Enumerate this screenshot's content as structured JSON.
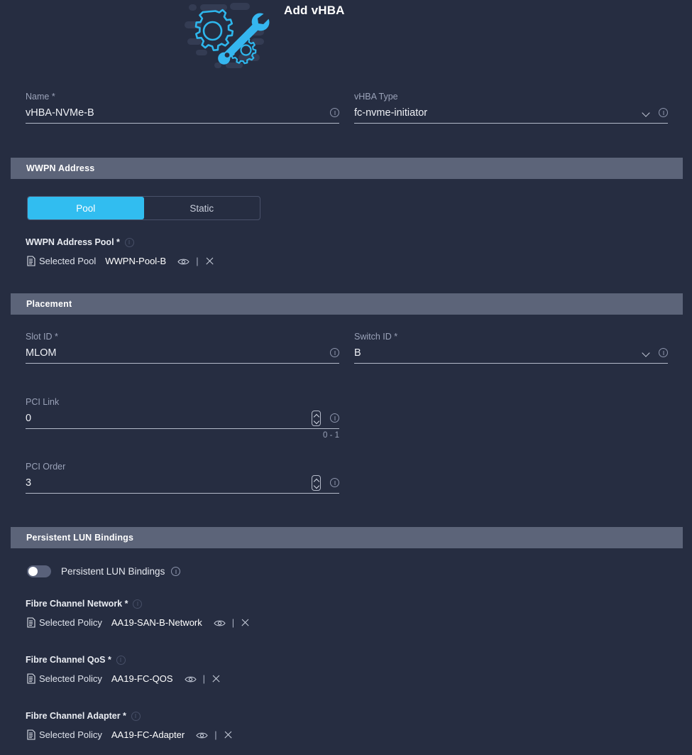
{
  "header": {
    "title": "Add vHBA",
    "art_icon": "gear-wrench-illustration"
  },
  "icons": {
    "info": "info-icon",
    "chevron_down": "chevron-down-icon",
    "spinner": "number-stepper-icon",
    "document": "policy-document-icon",
    "eye": "view-icon",
    "close": "remove-icon"
  },
  "colors": {
    "background": "#262d41",
    "section_band": "#5c6479",
    "accent": "#31bdf0",
    "underline": "#b4bac9",
    "label": "#9aa2b8",
    "value": "#eef0f5"
  },
  "fields": {
    "name": {
      "label": "Name *",
      "value": "vHBA-NVMe-B",
      "placeholder": "Name"
    },
    "vhba_type": {
      "label": "vHBA Type",
      "value": "fc-nvme-initiator",
      "placeholder": "vHBA Type"
    },
    "slot_id": {
      "label": "Slot ID *",
      "value": "MLOM",
      "placeholder": "Slot ID"
    },
    "switch_id": {
      "label": "Switch ID *",
      "value": "B",
      "placeholder": "Switch ID"
    },
    "pci_link": {
      "label": "PCI Link",
      "value": "0",
      "hint": "0 - 1",
      "placeholder": "PCI Link"
    },
    "pci_order": {
      "label": "PCI Order",
      "value": "3",
      "placeholder": "PCI Order"
    }
  },
  "sections": {
    "wwpn": {
      "band": "WWPN Address",
      "segmented": {
        "options": [
          "Pool",
          "Static"
        ],
        "selected": "Pool"
      },
      "pool_label": "WWPN Address Pool *",
      "selection": {
        "kind": "Selected Pool",
        "name": "WWPN-Pool-B"
      }
    },
    "placement": {
      "band": "Placement"
    },
    "lun": {
      "band": "Persistent LUN Bindings",
      "toggle": {
        "label": "Persistent LUN Bindings",
        "enabled": false
      },
      "policies": [
        {
          "label": "Fibre Channel Network *",
          "kind": "Selected Policy",
          "name": "AA19-SAN-B-Network"
        },
        {
          "label": "Fibre Channel QoS *",
          "kind": "Selected Policy",
          "name": "AA19-FC-QOS"
        },
        {
          "label": "Fibre Channel Adapter *",
          "kind": "Selected Policy",
          "name": "AA19-FC-Adapter"
        }
      ]
    }
  }
}
